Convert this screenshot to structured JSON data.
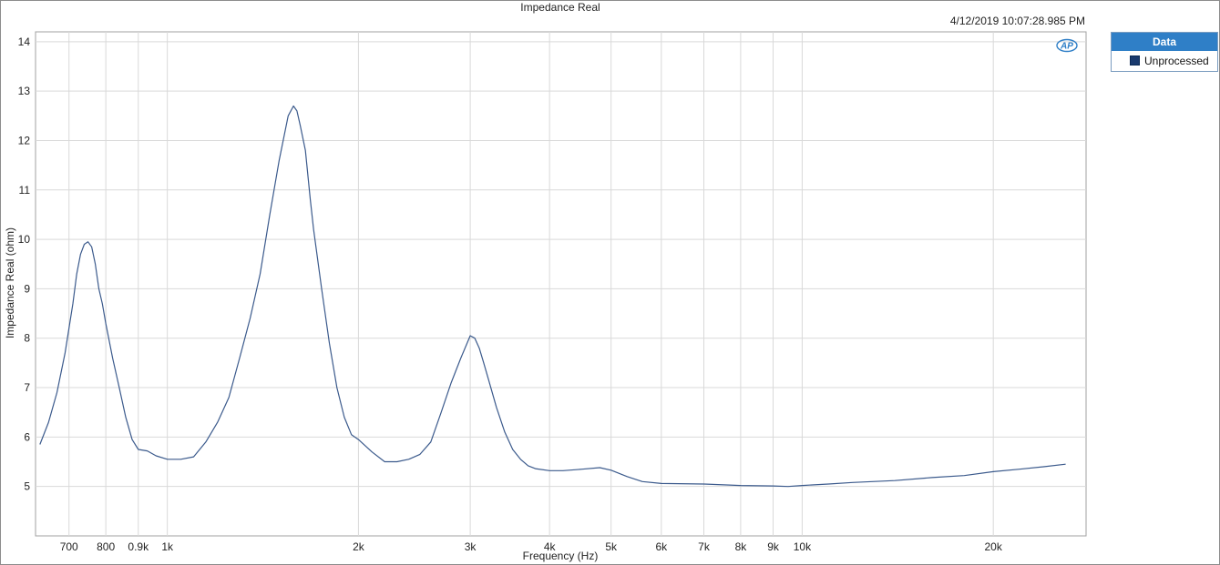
{
  "timestamp": "4/12/2019 10:07:28.985 PM",
  "logo_text": "AP",
  "legend": {
    "title": "Data",
    "items": [
      {
        "label": "Unprocessed",
        "color": "#1a3a6e"
      }
    ],
    "header_color": "#2f7fc7"
  },
  "chart_data": {
    "type": "line",
    "title": "Impedance Real",
    "xlabel": "Frequency (Hz)",
    "ylabel": "Impedance Real (ohm)",
    "x_scale": "log",
    "xlim": [
      620,
      28000
    ],
    "ylim": [
      4.0,
      14.2
    ],
    "grid": true,
    "legend_position": "right",
    "line_color": "#3b5a8c",
    "x_ticks": [
      {
        "value": 700,
        "label": "700"
      },
      {
        "value": 800,
        "label": "800"
      },
      {
        "value": 900,
        "label": "0.9k"
      },
      {
        "value": 1000,
        "label": "1k"
      },
      {
        "value": 2000,
        "label": "2k"
      },
      {
        "value": 3000,
        "label": "3k"
      },
      {
        "value": 4000,
        "label": "4k"
      },
      {
        "value": 5000,
        "label": "5k"
      },
      {
        "value": 6000,
        "label": "6k"
      },
      {
        "value": 7000,
        "label": "7k"
      },
      {
        "value": 8000,
        "label": "8k"
      },
      {
        "value": 9000,
        "label": "9k"
      },
      {
        "value": 10000,
        "label": "10k"
      },
      {
        "value": 20000,
        "label": "20k"
      }
    ],
    "y_ticks": [
      {
        "value": 5,
        "label": "5"
      },
      {
        "value": 6,
        "label": "6"
      },
      {
        "value": 7,
        "label": "7"
      },
      {
        "value": 8,
        "label": "8"
      },
      {
        "value": 9,
        "label": "9"
      },
      {
        "value": 10,
        "label": "10"
      },
      {
        "value": 11,
        "label": "11"
      },
      {
        "value": 12,
        "label": "12"
      },
      {
        "value": 13,
        "label": "13"
      },
      {
        "value": 14,
        "label": "14"
      }
    ],
    "series": [
      {
        "name": "Unprocessed",
        "x": [
          630,
          650,
          670,
          690,
          700,
          710,
          720,
          730,
          740,
          750,
          760,
          770,
          780,
          790,
          800,
          820,
          840,
          860,
          880,
          900,
          930,
          960,
          1000,
          1050,
          1100,
          1150,
          1200,
          1250,
          1300,
          1350,
          1400,
          1450,
          1500,
          1550,
          1580,
          1600,
          1620,
          1650,
          1680,
          1700,
          1750,
          1800,
          1850,
          1900,
          1950,
          2000,
          2100,
          2200,
          2300,
          2400,
          2500,
          2600,
          2700,
          2800,
          2900,
          3000,
          3050,
          3100,
          3150,
          3200,
          3300,
          3400,
          3500,
          3600,
          3700,
          3800,
          4000,
          4200,
          4500,
          4800,
          5000,
          5300,
          5600,
          6000,
          7000,
          8000,
          9000,
          9500,
          10000,
          11000,
          12000,
          14000,
          16000,
          18000,
          20000,
          22000,
          24000,
          26000
        ],
        "y": [
          5.85,
          6.3,
          6.9,
          7.7,
          8.2,
          8.7,
          9.3,
          9.7,
          9.9,
          9.95,
          9.85,
          9.5,
          9.0,
          8.7,
          8.3,
          7.6,
          7.0,
          6.4,
          5.95,
          5.75,
          5.72,
          5.62,
          5.55,
          5.55,
          5.6,
          5.9,
          6.3,
          6.8,
          7.6,
          8.4,
          9.3,
          10.5,
          11.6,
          12.5,
          12.7,
          12.6,
          12.3,
          11.8,
          10.8,
          10.2,
          9.0,
          7.9,
          7.0,
          6.4,
          6.05,
          5.95,
          5.7,
          5.5,
          5.5,
          5.55,
          5.65,
          5.9,
          6.5,
          7.1,
          7.6,
          8.05,
          8.0,
          7.8,
          7.5,
          7.2,
          6.6,
          6.1,
          5.75,
          5.55,
          5.42,
          5.36,
          5.32,
          5.32,
          5.35,
          5.38,
          5.33,
          5.2,
          5.1,
          5.06,
          5.05,
          5.02,
          5.01,
          5.0,
          5.02,
          5.05,
          5.08,
          5.12,
          5.18,
          5.22,
          5.3,
          5.35,
          5.4,
          5.45
        ]
      }
    ]
  }
}
